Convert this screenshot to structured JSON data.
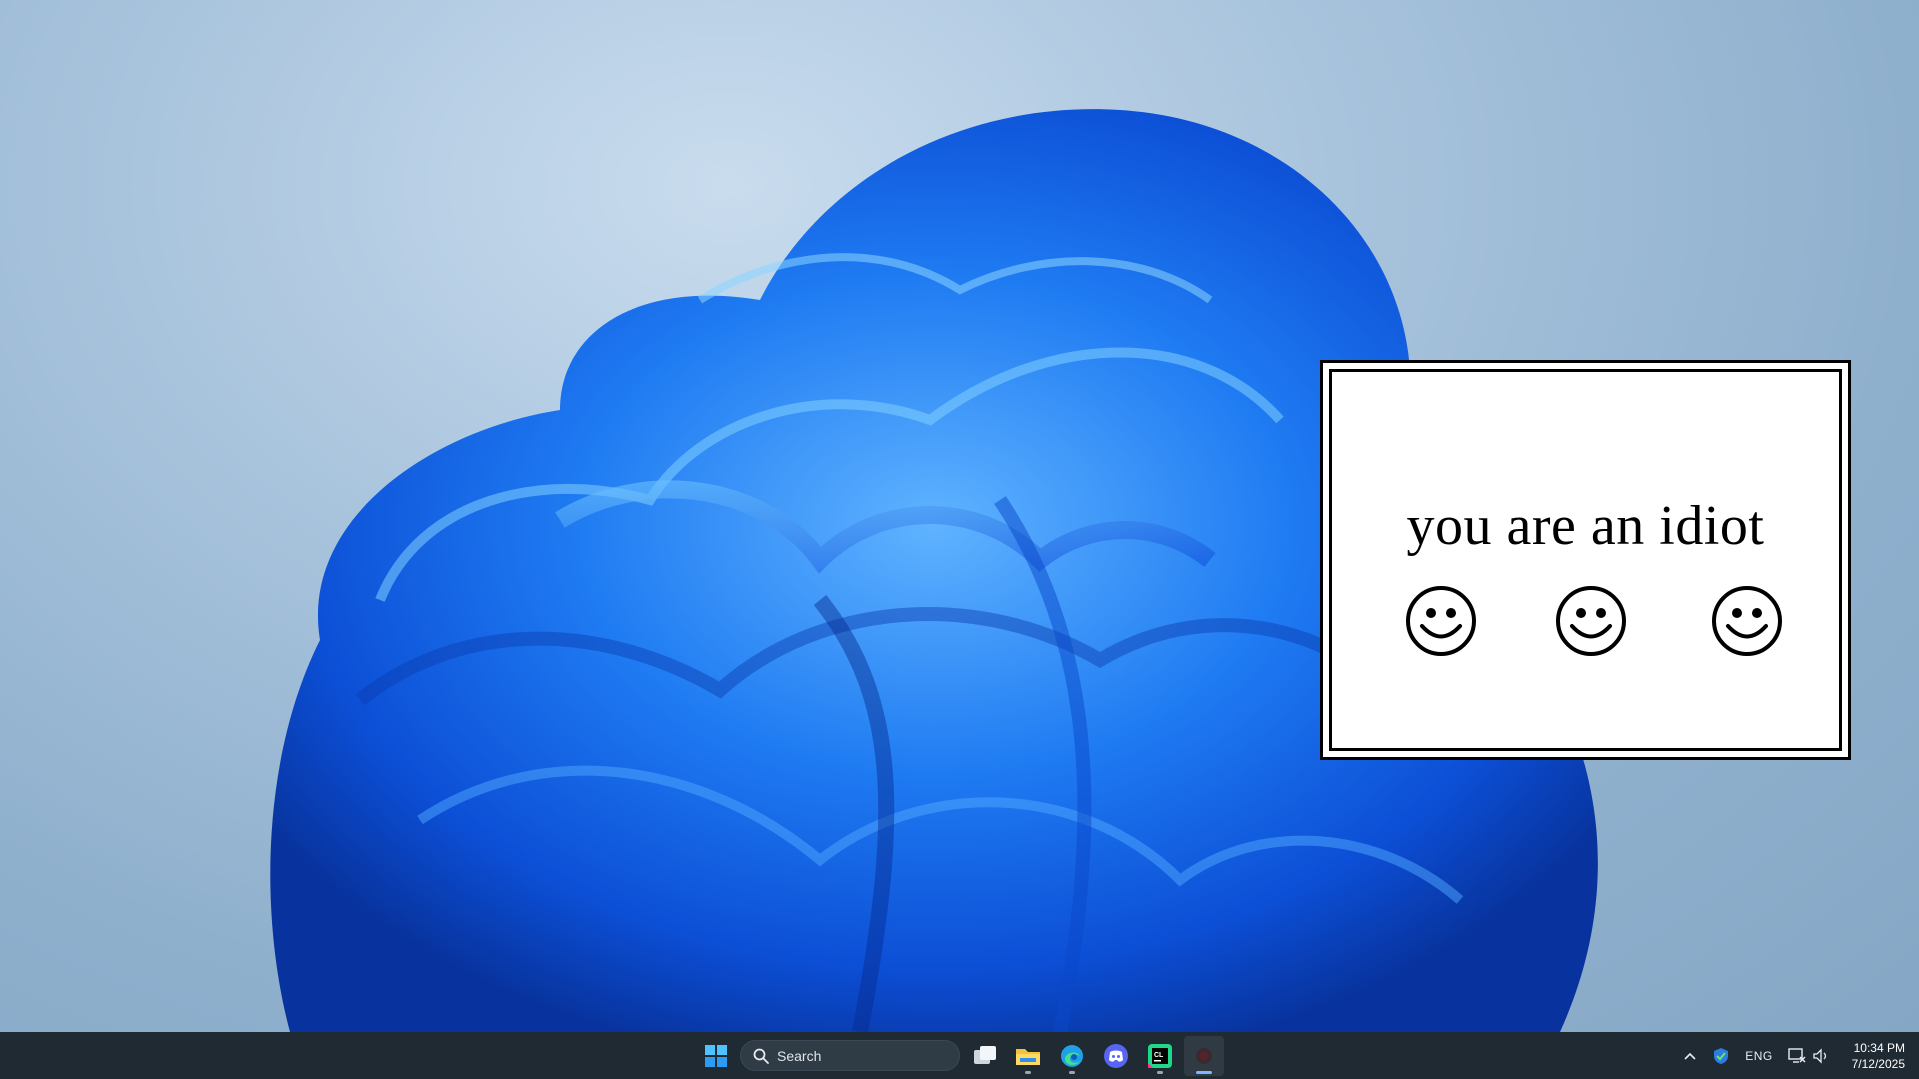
{
  "popup": {
    "message": "you are an idiot",
    "smiley_glyph": "smiley-face-icon"
  },
  "taskbar": {
    "search_label": "Search",
    "apps": [
      {
        "name": "start-icon"
      },
      {
        "name": "task-view-icon"
      },
      {
        "name": "file-explorer-icon"
      },
      {
        "name": "edge-icon"
      },
      {
        "name": "discord-icon"
      },
      {
        "name": "clion-icon"
      },
      {
        "name": "app-window-icon"
      }
    ]
  },
  "tray": {
    "language": "ENG",
    "time": "10:34 PM",
    "date": "7/12/2025"
  },
  "colors": {
    "taskbar_bg": "#1f2a33",
    "wallpaper_blue": "#1a6cf0",
    "popup_border": "#000000",
    "popup_bg": "#ffffff"
  }
}
